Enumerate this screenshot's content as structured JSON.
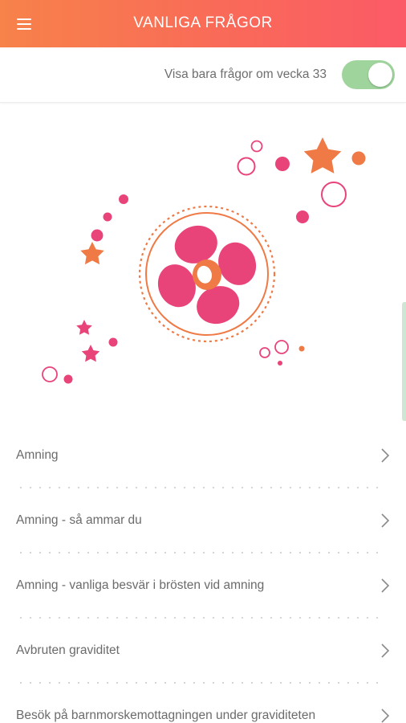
{
  "header": {
    "title": "VANLIGA FRÅGOR",
    "menu_icon": "hamburger-menu-icon"
  },
  "filter": {
    "label": "Visa bara frågor om vecka 33",
    "toggle_on": true
  },
  "colors": {
    "header_start": "#f7824a",
    "header_end": "#fb5a67",
    "toggle_on": "#9fd59c",
    "pink": "#e9447a",
    "orange": "#ef7a45"
  },
  "faq": {
    "items": [
      {
        "label": "Amning"
      },
      {
        "label": "Amning - så ammar du"
      },
      {
        "label": "Amning - vanliga besvär i brösten vid amning"
      },
      {
        "label": "Avbruten graviditet"
      },
      {
        "label": "Besök på barnmorskemottagningen under graviditeten"
      }
    ],
    "chevron_icon": "chevron-right-icon"
  }
}
